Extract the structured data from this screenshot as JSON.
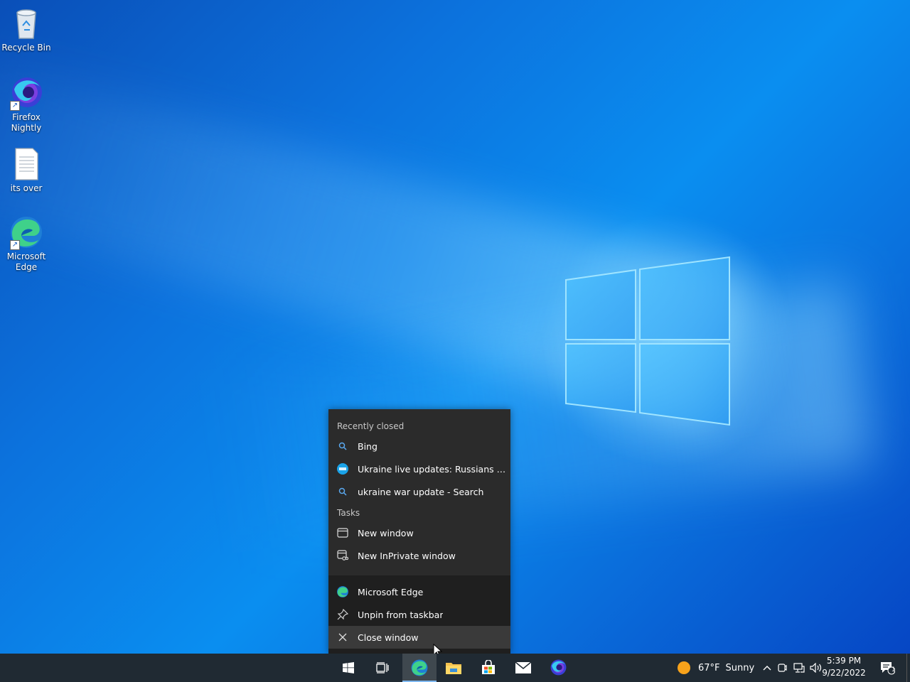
{
  "desktop": {
    "icons": [
      {
        "label": "Recycle Bin"
      },
      {
        "label": "Firefox Nightly"
      },
      {
        "label": "its over"
      },
      {
        "label": "Microsoft Edge"
      }
    ]
  },
  "jumplist": {
    "recent_heading": "Recently closed",
    "recent": [
      {
        "label": "Bing",
        "icon": "search-icon"
      },
      {
        "label": "Ukraine live updates: Russians protest,...",
        "icon": "site-favicon"
      },
      {
        "label": "ukraine war update - Search",
        "icon": "search-icon"
      }
    ],
    "tasks_heading": "Tasks",
    "tasks": [
      {
        "label": "New window",
        "icon": "window-icon"
      },
      {
        "label": "New InPrivate window",
        "icon": "inprivate-window-icon"
      }
    ],
    "app": [
      {
        "label": "Microsoft Edge",
        "icon": "edge-icon"
      },
      {
        "label": "Unpin from taskbar",
        "icon": "unpin-icon"
      },
      {
        "label": "Close window",
        "icon": "close-icon"
      }
    ]
  },
  "taskbar": {
    "weather_temp": "67°F",
    "weather_condition": "Sunny",
    "time": "5:39 PM",
    "date": "9/22/2022",
    "notification_count": "1"
  },
  "colors": {
    "accent": "#0a78d7",
    "taskbar": "#202a33",
    "jumplist": "#2b2b2b"
  }
}
